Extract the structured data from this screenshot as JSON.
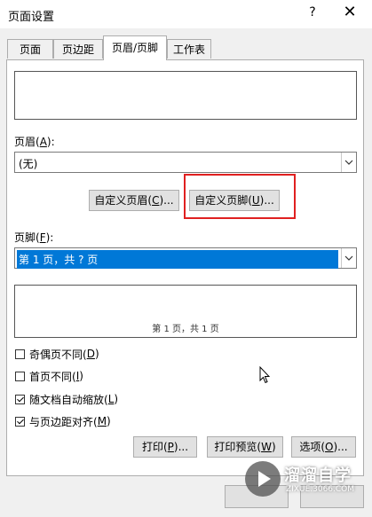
{
  "window": {
    "title": "页面设置",
    "help": "?",
    "close": "✕"
  },
  "tabs": [
    {
      "label": "页面"
    },
    {
      "label": "页边距"
    },
    {
      "label": "页眉/页脚"
    },
    {
      "label": "工作表"
    }
  ],
  "header": {
    "label": "页眉(",
    "hotkey": "A",
    "label_end": "):",
    "value": "(无)"
  },
  "buttons": {
    "custom_header_pre": "自定义页眉(",
    "custom_header_key": "C",
    "custom_header_post": ")...",
    "custom_footer_pre": "自定义页脚(",
    "custom_footer_key": "U",
    "custom_footer_post": ")...",
    "print_pre": "打印(",
    "print_key": "P",
    "print_post": ")...",
    "preview_pre": "打印预览(",
    "preview_key": "W",
    "preview_post": ")",
    "options_pre": "选项(",
    "options_key": "O",
    "options_post": ")..."
  },
  "footer": {
    "label": "页脚(",
    "hotkey": "F",
    "label_end": "):",
    "value": "第 1 页，共 ? 页",
    "preview_text": "第 1 页，共 1 页"
  },
  "options": [
    {
      "pre": "奇偶页不同(",
      "key": "D",
      "post": ")",
      "checked": false
    },
    {
      "pre": "首页不同(",
      "key": "I",
      "post": ")",
      "checked": false
    },
    {
      "pre": "随文档自动缩放(",
      "key": "L",
      "post": ")",
      "checked": true
    },
    {
      "pre": "与页边距对齐(",
      "key": "M",
      "post": ")",
      "checked": true
    }
  ],
  "watermark": {
    "name": "溜溜自学",
    "url": "ZIXUE.3066.COM"
  },
  "colors": {
    "selection": "#0078d7",
    "highlight": "#e02020"
  }
}
